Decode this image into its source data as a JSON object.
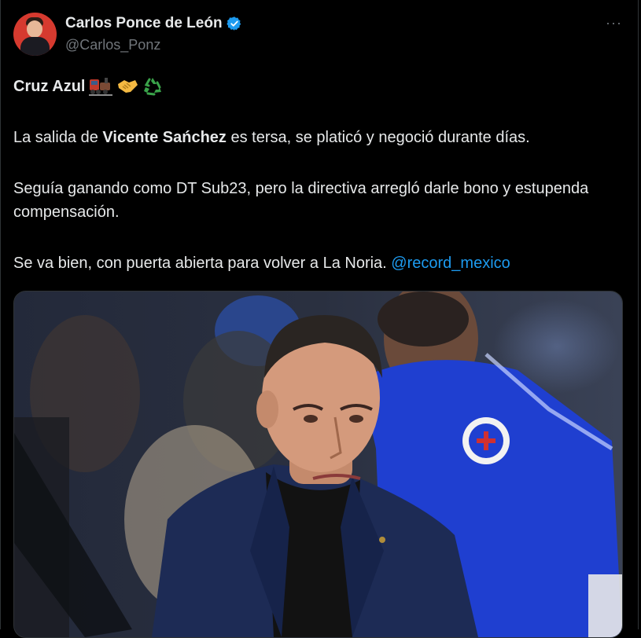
{
  "author": {
    "display_name": "Carlos Ponce de León",
    "handle": "@Carlos_Ponz",
    "verified": true,
    "avatar_icon": "profile-avatar"
  },
  "actions": {
    "more_icon": "more-horizontal-icon",
    "more_label": "···"
  },
  "tweet": {
    "p1_text": "Cruz Azul",
    "p1_emoji": [
      "train-icon",
      "handshake-icon",
      "recycle-icon"
    ],
    "p2_before": "La salida de ",
    "p2_bold": "Vicente Sańchez",
    "p2_after": " es tersa, se platicó y negoció durante días.",
    "p3": "Seguía ganando como DT Sub23, pero la directiva arregló darle bono y estupenda compensación.",
    "p4_text": "Se va bien, con puerta abierta para volver a La Noria. ",
    "p4_mention": "@record_mexico"
  },
  "colors": {
    "background": "#000000",
    "text": "#e7e9ea",
    "muted": "#71767b",
    "link": "#1d9bf0",
    "verified": "#1d9bf0"
  },
  "media": {
    "type": "photo",
    "subject": "coach-in-navy-blazer",
    "background_subject": "player-in-blue-jacket"
  }
}
